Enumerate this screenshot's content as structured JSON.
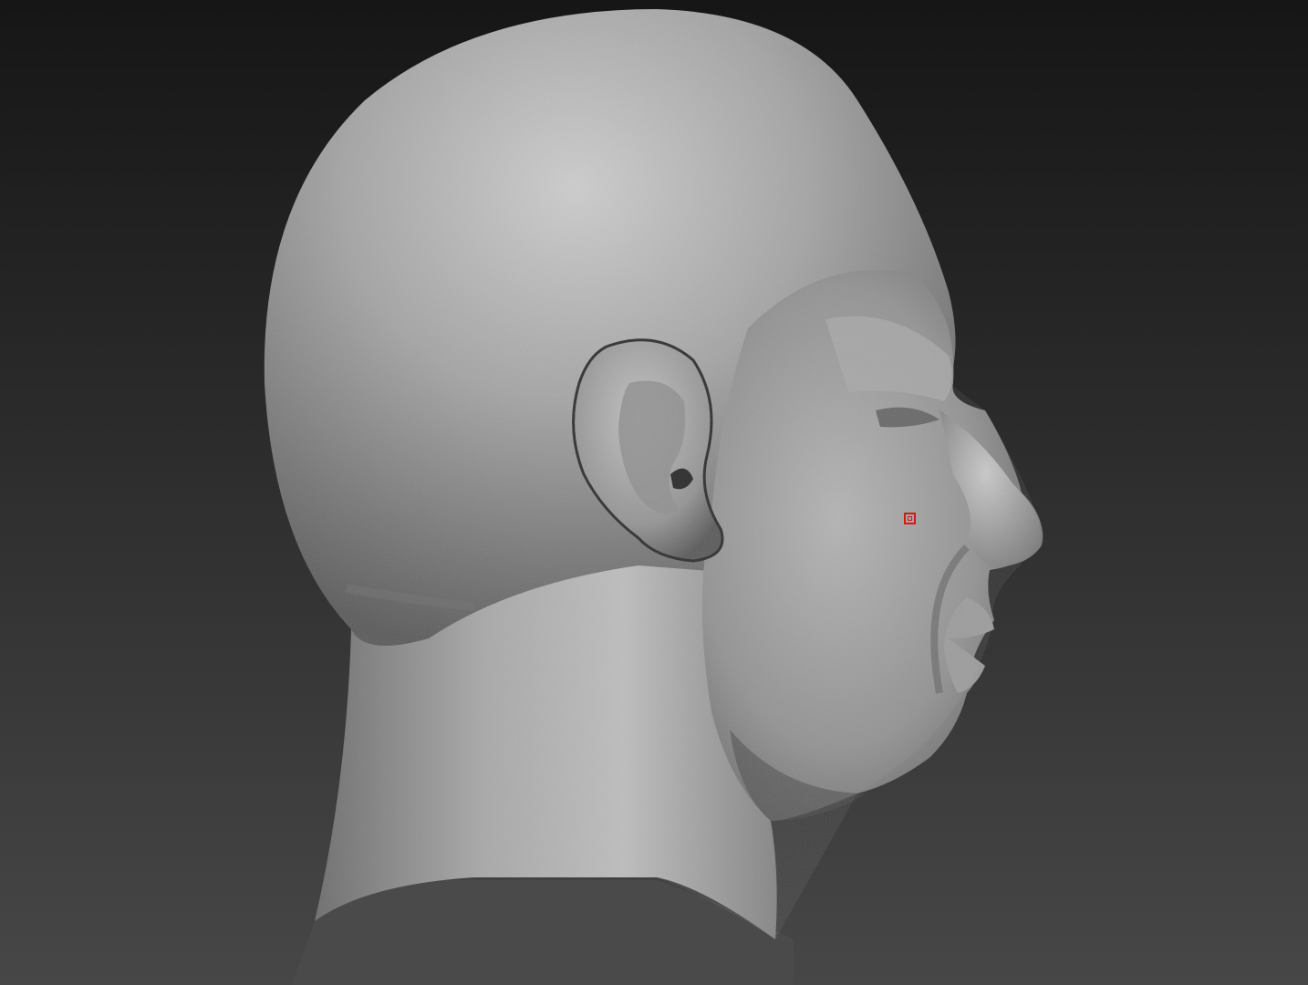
{
  "viewport": {
    "bg_top": "#161616",
    "bg_bottom": "#474747",
    "model_shade_light": "#c9c9c9",
    "model_shade_mid": "#8e8e8e",
    "model_shade_dark": "#3c3c3c"
  },
  "cursor": {
    "icon": "brush-cursor-icon",
    "color": "#d11a1a"
  }
}
